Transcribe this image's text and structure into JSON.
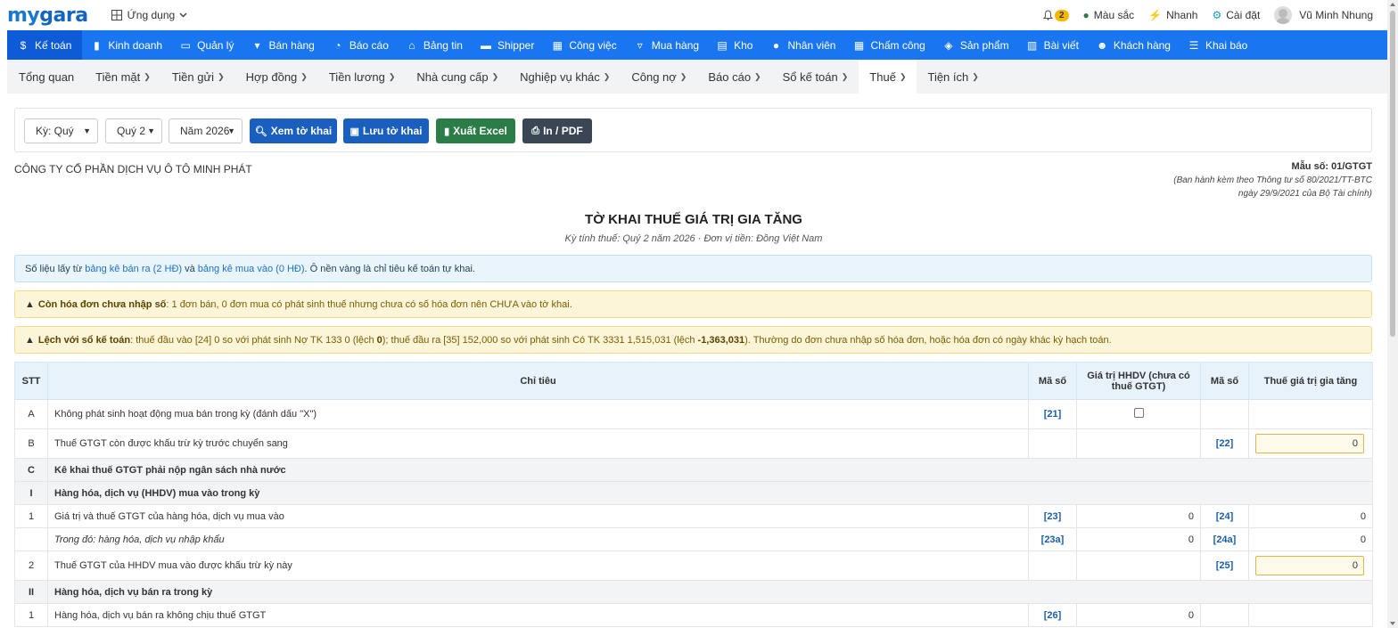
{
  "brand": {
    "logo_prefix": "my",
    "logo_suffix": "gara"
  },
  "apps_label": "Ứng dụng",
  "topright": {
    "notif_count": "2",
    "color_label": "Màu sắc",
    "quick_label": "Nhanh",
    "settings_label": "Cài đặt",
    "user_name": "Vũ Minh Nhung"
  },
  "mainnav": [
    {
      "label": "Kế toán",
      "icon": "$"
    },
    {
      "label": "Kinh doanh",
      "icon": "bag"
    },
    {
      "label": "Quản lý",
      "icon": "id-card"
    },
    {
      "label": "Bán hàng",
      "icon": "cart"
    },
    {
      "label": "Báo cáo",
      "icon": "pie"
    },
    {
      "label": "Bảng tin",
      "icon": "home"
    },
    {
      "label": "Shipper",
      "icon": "truck"
    },
    {
      "label": "Công việc",
      "icon": "calendar"
    },
    {
      "label": "Mua hàng",
      "icon": "basket"
    },
    {
      "label": "Kho",
      "icon": "warehouse"
    },
    {
      "label": "Nhân viên",
      "icon": "user"
    },
    {
      "label": "Chấm công",
      "icon": "calendar"
    },
    {
      "label": "Sản phẩm",
      "icon": "box"
    },
    {
      "label": "Bài viết",
      "icon": "book"
    },
    {
      "label": "Khách hàng",
      "icon": "smile"
    },
    {
      "label": "Khai báo",
      "icon": "list"
    }
  ],
  "subnav": [
    {
      "label": "Tổng quan"
    },
    {
      "label": "Tiền mặt"
    },
    {
      "label": "Tiền gửi"
    },
    {
      "label": "Hợp đồng"
    },
    {
      "label": "Tiền lương"
    },
    {
      "label": "Nhà cung cấp"
    },
    {
      "label": "Nghiệp vụ khác"
    },
    {
      "label": "Công nợ"
    },
    {
      "label": "Báo cáo"
    },
    {
      "label": "Sổ kế toán"
    },
    {
      "label": "Thuế"
    },
    {
      "label": "Tiện ích"
    }
  ],
  "toolbar": {
    "period_type": "Kỳ: Quý",
    "quarter": "Quý 2",
    "year": "Năm 2026",
    "view_label": "Xem tờ khai",
    "save_label": "Lưu tờ khai",
    "excel_label": "Xuất Excel",
    "pdf_label": "In / PDF"
  },
  "header": {
    "company": "CÔNG TY CỔ PHẦN DỊCH VỤ Ô TÔ MINH PHÁT",
    "form_no": "Mẫu số: 01/GTGT",
    "form_note1": "(Ban hành kèm theo Thông tư số 80/2021/TT-BTC",
    "form_note2": "ngày 29/9/2021 của Bộ Tài chính)",
    "title": "TỜ KHAI THUẾ GIÁ TRỊ GIA TĂNG",
    "subtitle": "Kỳ tính thuế: Quý 2 năm 2026  ·  Đơn vị tiền: Đồng Việt Nam"
  },
  "info": {
    "prefix": "Số liệu lấy từ",
    "link1": "bảng kê bán ra (2 HĐ)",
    "mid": "và",
    "link2": "bảng kê mua vào (0 HĐ)",
    "suffix": ". Ô nền vàng là chỉ tiêu kế toán tự khai."
  },
  "warn1": {
    "bold": "Còn hóa đơn chưa nhập số",
    "text": ": 1 đơn bán, 0 đơn mua có phát sinh thuế nhưng chưa có số hóa đơn nên CHƯA vào tờ khai."
  },
  "warn2": {
    "bold": "Lệch với sổ kế toán",
    "t1": ": thuế đầu vào [24] 0 so với phát sinh Nợ TK 133 0 (lệch",
    "b1": "0",
    "t2": "); thuế đầu ra [35] 152,000 so với phát sinh Có TK 3331 1,515,031 (lệch",
    "b2": "-1,363,031",
    "t3": "). Thường do đơn chưa nhập số hóa đơn, hoặc hóa đơn có ngày khác kỳ hạch toán."
  },
  "table": {
    "headers": {
      "stt": "STT",
      "chi_tieu": "Chỉ tiêu",
      "ma_so1": "Mã số",
      "gia_tri": "Giá trị HHDV (chưa có thuế GTGT)",
      "ma_so2": "Mã số",
      "thue": "Thuế giá trị gia tăng"
    },
    "rows": [
      {
        "stt": "A",
        "label": "Không phát sinh hoạt động mua bán trong kỳ (đánh dấu \"X\")",
        "code1": "[21]",
        "value": "",
        "code2": "",
        "tax": ""
      },
      {
        "stt": "B",
        "label": "Thuế GTGT còn được khấu trừ kỳ trước chuyển sang",
        "code1": "",
        "value": "",
        "code2": "[22]",
        "tax": "0"
      },
      {
        "stt": "C",
        "label": "Kê khai thuế GTGT phải nộp ngân sách nhà nước"
      },
      {
        "stt": "I",
        "label": "Hàng hóa, dịch vụ (HHDV) mua vào trong kỳ"
      },
      {
        "stt": "1",
        "label": "Giá trị và thuế GTGT của hàng hóa, dịch vụ mua vào",
        "code1": "[23]",
        "value": "0",
        "code2": "[24]",
        "tax": "0"
      },
      {
        "stt": "",
        "label": "Trong đó: hàng hóa, dịch vụ nhập khẩu",
        "code1": "[23a]",
        "value": "0",
        "code2": "[24a]",
        "tax": "0"
      },
      {
        "stt": "2",
        "label": "Thuế GTGT của HHDV mua vào được khấu trừ kỳ này",
        "code1": "",
        "value": "",
        "code2": "[25]",
        "tax": "0"
      },
      {
        "stt": "II",
        "label": "Hàng hóa, dịch vụ bán ra trong kỳ"
      },
      {
        "stt": "1",
        "label": "Hàng hóa, dịch vụ bán ra không chịu thuế GTGT",
        "code1": "[26]",
        "value": "0",
        "code2": "",
        "tax": ""
      }
    ]
  },
  "colors": {
    "primary": "#1976f0",
    "active_nav": "#0d5bd6",
    "btn_view": "#1a5fc0",
    "btn_excel": "#2a7d46",
    "btn_pdf": "#3a4654"
  }
}
